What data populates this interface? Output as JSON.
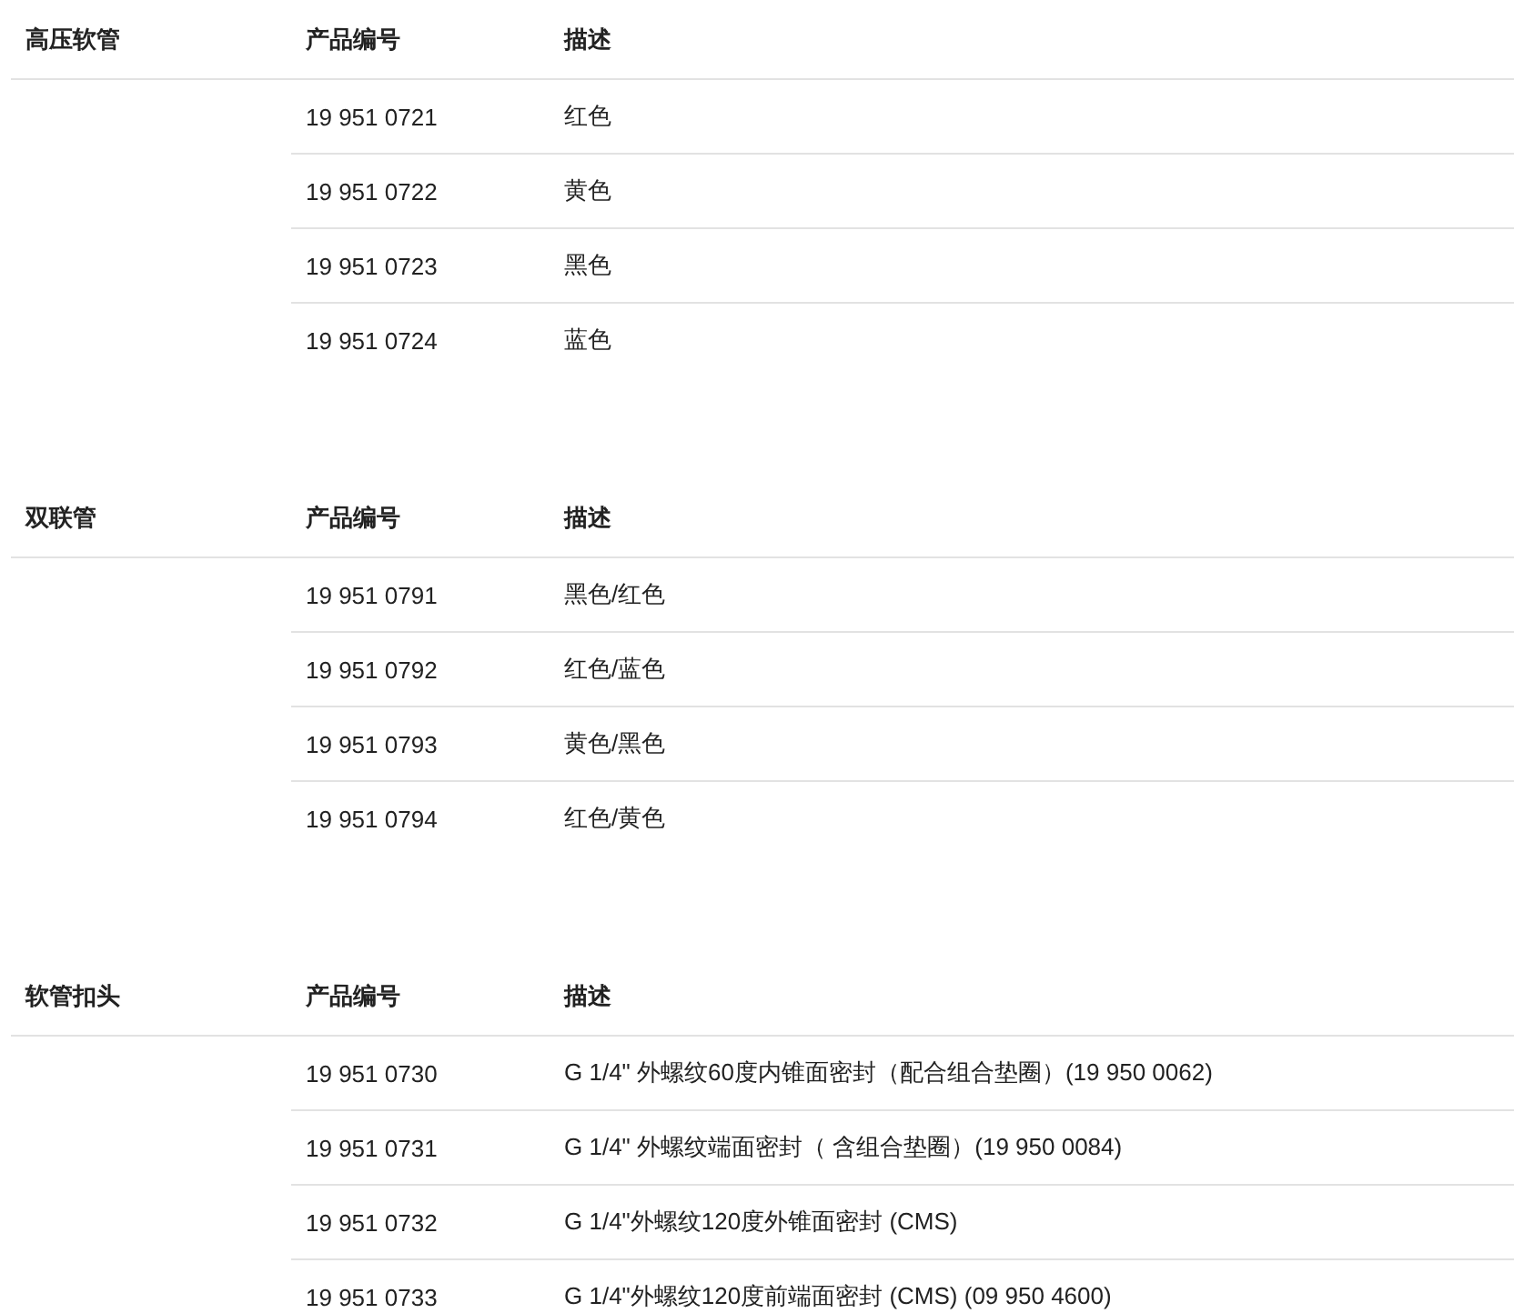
{
  "sections": [
    {
      "title": "高压软管",
      "columns": [
        "产品编号",
        "描述"
      ],
      "rows": [
        {
          "code": "19 951 0721",
          "description": "红色"
        },
        {
          "code": "19 951 0722",
          "description": "黄色"
        },
        {
          "code": "19 951 0723",
          "description": "黑色"
        },
        {
          "code": "19 951 0724",
          "description": "蓝色"
        }
      ]
    },
    {
      "title": "双联管",
      "columns": [
        "产品编号",
        "描述"
      ],
      "rows": [
        {
          "code": "19 951 0791",
          "description": "黑色/红色"
        },
        {
          "code": "19 951 0792",
          "description": "红色/蓝色"
        },
        {
          "code": "19 951 0793",
          "description": "黄色/黑色"
        },
        {
          "code": "19 951 0794",
          "description": "红色/黄色"
        }
      ]
    },
    {
      "title": "软管扣头",
      "columns": [
        "产品编号",
        "描述"
      ],
      "rows": [
        {
          "code": "19 951 0730",
          "description": "G 1/4\" 外螺纹60度内锥面密封（配合组合垫圈）(19 950 0062)"
        },
        {
          "code": "19 951 0731",
          "description": "G 1/4\" 外螺纹端面密封（ 含组合垫圈）(19 950 0084)"
        },
        {
          "code": "19 951 0732",
          "description": "G 1/4\"外螺纹120度外锥面密封 (CMS)"
        },
        {
          "code": "19 951 0733",
          "description": "G 1/4\"外螺纹120度前端面密封 (CMS) (09 950 4600)"
        }
      ]
    }
  ]
}
